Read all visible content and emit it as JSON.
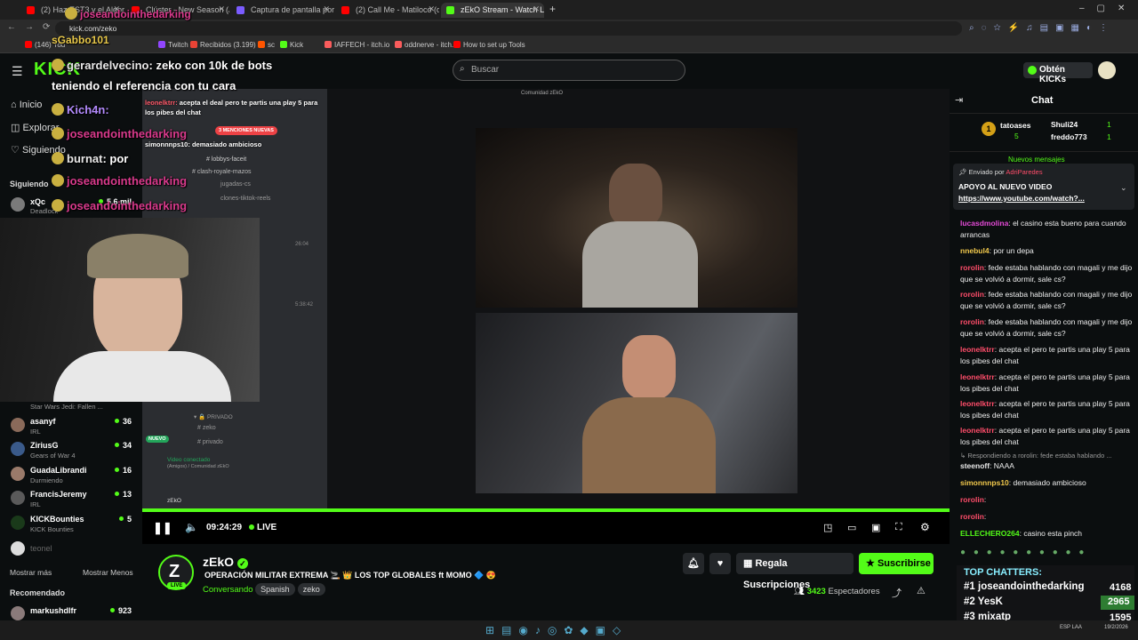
{
  "browser": {
    "tabs": [
      {
        "label": "(2) Haz EST3 y el Algoritmo de",
        "color": "#ff0000"
      },
      {
        "label": "Clúster - New Season (Audio",
        "color": "#ff0000"
      },
      {
        "label": "Captura de pantalla por Lightsh",
        "color": "#7b5cff"
      },
      {
        "label": "(2) Call Me - Matiloco (dir. @fr",
        "color": "#ff0000"
      },
      {
        "label": "zEkO Stream - Watch Live o",
        "color": "#53fc18",
        "active": true
      }
    ],
    "url": "kick.com/zeko",
    "bookmarks": [
      "(146) You",
      "Twitch",
      "Recibidos (3.199) -",
      "sc",
      "Kick",
      "IAFFECH - itch.io",
      "oddnerve - itch.io",
      "How to set up Tools"
    ]
  },
  "header": {
    "logo": "KICK",
    "search_placeholder": "Buscar",
    "kicks_button": "Obtén KICKs"
  },
  "sidebar": {
    "nav": [
      "Inicio",
      "Explorar",
      "Siguiendo"
    ],
    "following_title": "Siguiendo",
    "channels": [
      {
        "name": "xQc",
        "sub": "Deadlock",
        "count": "5,6 mil"
      },
      {
        "name": "",
        "sub": "Star Wars Jedi: Fallen ...",
        "count": ""
      },
      {
        "name": "asanyf",
        "sub": "IRL",
        "count": "36"
      },
      {
        "name": "ZiriusG",
        "sub": "Gears of War 4",
        "count": "34"
      },
      {
        "name": "GuadaLibrandi",
        "sub": "Durmiendo",
        "count": "16"
      },
      {
        "name": "FrancisJeremy",
        "sub": "IRL",
        "count": "13"
      },
      {
        "name": "KICKBounties",
        "sub": "KICK Bounties",
        "count": "5"
      },
      {
        "name": "teonel",
        "sub": "",
        "count": ""
      }
    ],
    "show_more": "Mostrar más",
    "show_less": "Mostrar Menos",
    "recommended_title": "Recomendado",
    "recommended": [
      {
        "name": "markushdlfr",
        "count": "923"
      }
    ]
  },
  "overlay_chat": [
    {
      "user": "joseandointhedarking",
      "text": "",
      "color": "#d93a8c"
    },
    {
      "user": "sGabbo101",
      "text": "",
      "color": "#e8c84a"
    },
    {
      "user": "gerardelvecino",
      "text": ": zeko con 10k de bots",
      "color": "#e8e8e8"
    },
    {
      "user": "",
      "text": "teniendo el referencia con tu cara",
      "color": "#e8e8e8"
    },
    {
      "user": "Kich4n",
      "text": ":",
      "color": "#b48cff"
    },
    {
      "user": "joseandointhedarking",
      "text": "",
      "color": "#d93a8c"
    },
    {
      "user": "burnat",
      "text": ": por",
      "color": "#e8e8e8"
    },
    {
      "user": "joseandointhedarking",
      "text": "",
      "color": "#d93a8c"
    },
    {
      "user": "joseandointhedarking",
      "text": "",
      "color": "#d93a8c"
    }
  ],
  "discord": {
    "title": "Comunidad zEkO",
    "messages": [
      {
        "user": "leonelktrr",
        "text": "acepta el deal pero te partis una play 5 para los pibes del chat"
      },
      {
        "user": "simonnnps10",
        "text": "demasiado ambicioso"
      }
    ],
    "mentions_badge": "3 MENCIONES NUEVAS",
    "channels": [
      "lobbys-faceit",
      "clash-royale-mazos",
      "jugadas-cs",
      "clones-tiktok-reels"
    ],
    "private_label": "PRIVADO",
    "private_channels": [
      "zeko",
      "privado"
    ],
    "new_badge": "NUEVO",
    "voice_status": "Video conectado",
    "voice_sub": "(Amigos) / Comunidad zEkO",
    "user": "zEkO",
    "times": [
      "26:04",
      "5:38:42"
    ]
  },
  "player": {
    "time": "09:24:29",
    "live": "LIVE"
  },
  "stream": {
    "channel": "zEkO",
    "live_badge": "LIVE",
    "title": "OPERACIÓN MILITAR EXTREMA 🚬 👑 LOS TOP GLOBALES ft MOMO 🔷 😍",
    "category": "Conversando",
    "tags": [
      "Spanish",
      "zeko"
    ],
    "gift_button": "Regala Suscripciones",
    "subscribe_button": "Suscribirse",
    "viewers": "3423",
    "viewers_label": "Espectadores"
  },
  "chat": {
    "title": "Chat",
    "gifters": [
      {
        "name": "tatoases",
        "count": "5"
      },
      {
        "name": "Shuli24",
        "count": "1"
      },
      {
        "name": "freddo773",
        "count": "1"
      }
    ],
    "new_messages": "Nuevos mensajes",
    "pinned_by_label": "Enviado por",
    "pinned_user": "AdriParedes",
    "pinned_title": "APOYO AL NUEVO VIDEO",
    "pinned_link": "https://www.youtube.com/watch?...",
    "messages": [
      {
        "user": "lucasdmolina",
        "color": "#e34ad6",
        "text": "el casino esta bueno para cuando arrancas"
      },
      {
        "user": "nnebul4",
        "color": "#f2c94c",
        "text": "por un depa"
      },
      {
        "user": "rorolin",
        "color": "#ff4d6a",
        "text": "fede estaba hablando con magali y me dijo que se volvió a dormir, sale cs?"
      },
      {
        "user": "rorolin",
        "color": "#ff4d6a",
        "text": "fede estaba hablando con magali y me dijo que se volvió a dormir, sale cs?"
      },
      {
        "user": "rorolin",
        "color": "#ff4d6a",
        "text": "fede estaba hablando con magali y me dijo que se volvió a dormir, sale cs?"
      },
      {
        "user": "leonelktrr",
        "color": "#ff4d6a",
        "text": "acepta el          pero te partis una play 5 para los pibes del chat"
      },
      {
        "user": "leonelktrr",
        "color": "#ff4d6a",
        "text": "acepta el          pero te partis una play 5 para los pibes del chat"
      },
      {
        "user": "leonelktrr",
        "color": "#ff4d6a",
        "text": "acepta el          pero te partis una play 5 para los pibes del chat"
      },
      {
        "user": "leonelktrr",
        "color": "#ff4d6a",
        "text": "acepta el          pero te partis una play 5 para los pibes del chat"
      }
    ],
    "reply_note": "Respondiendo a rorolin: fede estaba hablando ...",
    "messages2": [
      {
        "user": "steenoff",
        "color": "#e8e8e8",
        "text": "NAAA"
      },
      {
        "user": "simonnnps10",
        "color": "#f2c94c",
        "text": "demasiado ambicioso"
      },
      {
        "user": "rorolin",
        "color": "#ff4d6a",
        "text": ""
      },
      {
        "user": "rorolin",
        "color": "#ff4d6a",
        "text": ""
      },
      {
        "user": "ELLECHERO264",
        "color": "#53fc18",
        "text": "casino esta pinch"
      }
    ],
    "top_chatters_title": "TOP CHATTERS:",
    "top_chatters": [
      {
        "rank": "#1",
        "name": "joseandointhedarking",
        "count": "4168"
      },
      {
        "rank": "#2",
        "name": "YesK",
        "count": "2965"
      },
      {
        "rank": "#3",
        "name": "mixatp",
        "count": "1595"
      }
    ]
  },
  "taskbar": {
    "lang": "ESP LAA",
    "date": "19/2/2026"
  }
}
